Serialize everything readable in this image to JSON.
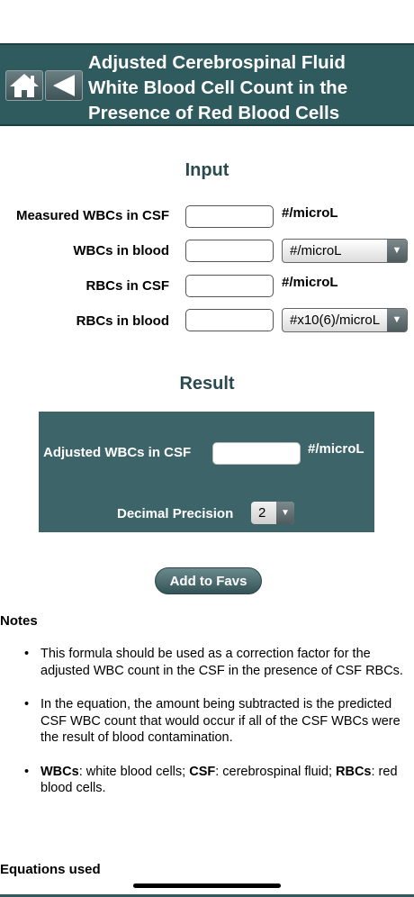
{
  "header": {
    "title_lines": [
      "Adjusted Cerebrospinal Fluid",
      "White Blood Cell Count in the",
      "Presence of Red Blood Cells"
    ]
  },
  "input": {
    "heading": "Input",
    "rows": [
      {
        "label": "Measured WBCs in CSF",
        "value": "",
        "unit": "#/microL"
      },
      {
        "label": "WBCs in blood",
        "value": "",
        "unit_select": "#/microL"
      },
      {
        "label": "RBCs in CSF",
        "value": "",
        "unit": "#/microL"
      },
      {
        "label": "RBCs in blood",
        "value": "",
        "unit_select": "#x10(6)/microL"
      }
    ]
  },
  "result": {
    "heading": "Result",
    "label": "Adjusted WBCs in CSF",
    "value": "",
    "unit": "#/microL",
    "precision_label": "Decimal Precision",
    "precision_value": "2"
  },
  "actions": {
    "add_favs": "Add to Favs"
  },
  "notes": {
    "heading": "Notes",
    "items": [
      "This formula should be used as a correction factor for the adjusted WBC count in the CSF in the presence of CSF RBCs.",
      "In the equation, the amount being subtracted is the predicted CSF WBC count that would occur if all of the CSF WBCs were the result of blood contamination."
    ],
    "abbrev": {
      "wbc_term": "WBCs",
      "wbc_def": ": white blood cells; ",
      "csf_term": "CSF",
      "csf_def": ": cerebrospinal fluid; ",
      "rbc_term": "RBCs",
      "rbc_def": ": red blood cells."
    }
  },
  "equations": {
    "heading": "Equations used"
  },
  "icons": {
    "home": "home-icon",
    "back": "back-arrow-icon",
    "dropdown": "chevron-down-icon"
  },
  "colors": {
    "header_bg": "#2f5a5e",
    "panel_bg": "#3d6569",
    "heading_text": "#2a4a4f"
  }
}
